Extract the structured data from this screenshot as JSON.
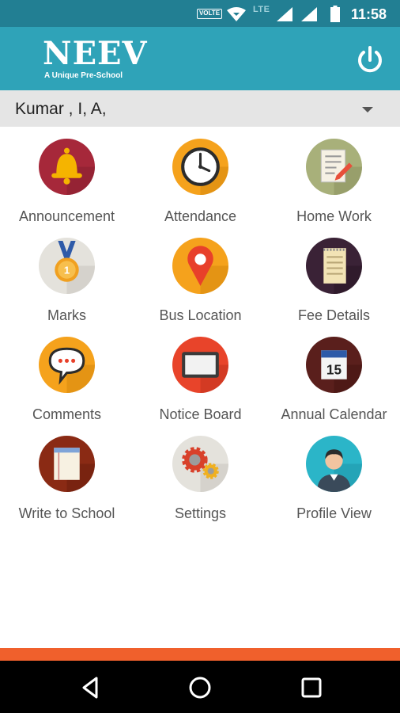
{
  "status_bar": {
    "volte": "VOLTE",
    "network": "LTE",
    "time": "11:58"
  },
  "app_bar": {
    "logo_title": "NEEV",
    "logo_subtitle": "A Unique Pre-School",
    "power_icon": "power-icon"
  },
  "student_selector": {
    "value": "Kumar , I, A,"
  },
  "menu": [
    {
      "label": "Announcement",
      "icon": "bell-icon"
    },
    {
      "label": "Attendance",
      "icon": "clock-icon"
    },
    {
      "label": "Home Work",
      "icon": "notebook-pencil-icon"
    },
    {
      "label": "Marks",
      "icon": "medal-icon"
    },
    {
      "label": "Bus Location",
      "icon": "location-pin-icon"
    },
    {
      "label": "Fee Details",
      "icon": "notepad-icon"
    },
    {
      "label": "Comments",
      "icon": "speech-bubble-icon"
    },
    {
      "label": "Notice Board",
      "icon": "notice-board-icon"
    },
    {
      "label": "Annual Calendar",
      "icon": "calendar-icon"
    },
    {
      "label": "Write to School",
      "icon": "write-pad-icon"
    },
    {
      "label": "Settings",
      "icon": "gears-icon"
    },
    {
      "label": "Profile View",
      "icon": "user-avatar-icon"
    }
  ],
  "calendar_day": "15",
  "medal_number": "1",
  "colors": {
    "app_bar": "#2fa3b8",
    "status_bar": "#227f93",
    "accent_strip": "#f0602c"
  }
}
